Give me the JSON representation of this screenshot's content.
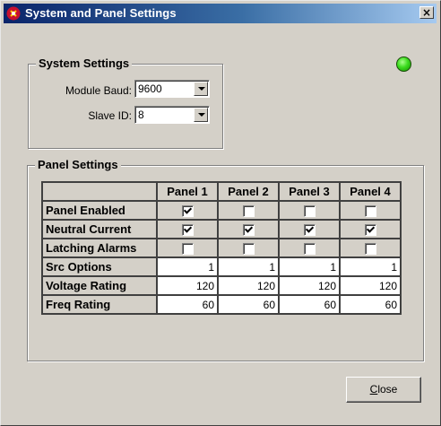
{
  "window": {
    "title": "System and Panel Settings",
    "close_glyph": "×"
  },
  "system_settings": {
    "legend": "System Settings",
    "module_baud": {
      "label": "Module Baud:",
      "value": "9600"
    },
    "slave_id": {
      "label": "Slave ID:",
      "value": "8"
    }
  },
  "status_led": {
    "color": "#33dd22",
    "icon": "status-led-green"
  },
  "panel_settings": {
    "legend": "Panel Settings",
    "columns": [
      "Panel 1",
      "Panel 2",
      "Panel 3",
      "Panel 4"
    ],
    "rows": [
      {
        "label": "Panel Enabled",
        "type": "check",
        "values": [
          true,
          false,
          false,
          false
        ]
      },
      {
        "label": "Neutral Current",
        "type": "check",
        "values": [
          true,
          true,
          true,
          true
        ]
      },
      {
        "label": "Latching Alarms",
        "type": "check",
        "values": [
          false,
          false,
          false,
          false
        ]
      },
      {
        "label": "Src Options",
        "type": "number",
        "values": [
          "1",
          "1",
          "1",
          "1"
        ]
      },
      {
        "label": "Voltage Rating",
        "type": "number",
        "values": [
          "120",
          "120",
          "120",
          "120"
        ]
      },
      {
        "label": "Freq Rating",
        "type": "number",
        "values": [
          "60",
          "60",
          "60",
          "60"
        ]
      }
    ]
  },
  "buttons": {
    "close_mnemonic": "C",
    "close_rest": "lose"
  }
}
